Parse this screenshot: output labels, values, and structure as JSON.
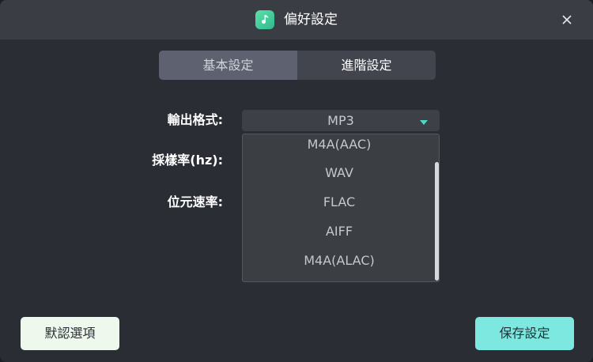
{
  "window": {
    "title": "偏好設定"
  },
  "tabs": [
    {
      "label": "基本設定",
      "active": true
    },
    {
      "label": "進階設定",
      "active": false
    }
  ],
  "settings": {
    "output_format_label": "輸出格式:",
    "sample_rate_label": "採樣率(hz):",
    "bitrate_label": "位元速率:",
    "output_format_value": "MP3"
  },
  "dropdown": {
    "options": [
      "M4A(AAC)",
      "WAV",
      "FLAC",
      "AIFF",
      "M4A(ALAC)"
    ]
  },
  "buttons": {
    "default_label": "默認選項",
    "save_label": "保存設定"
  },
  "colors": {
    "accent": "#7de8df",
    "caret": "#4fd8c6",
    "app_icon": "#3cc99a"
  },
  "icons": {
    "app": "music-note-icon",
    "close": "close-icon",
    "caret": "caret-down-icon"
  }
}
